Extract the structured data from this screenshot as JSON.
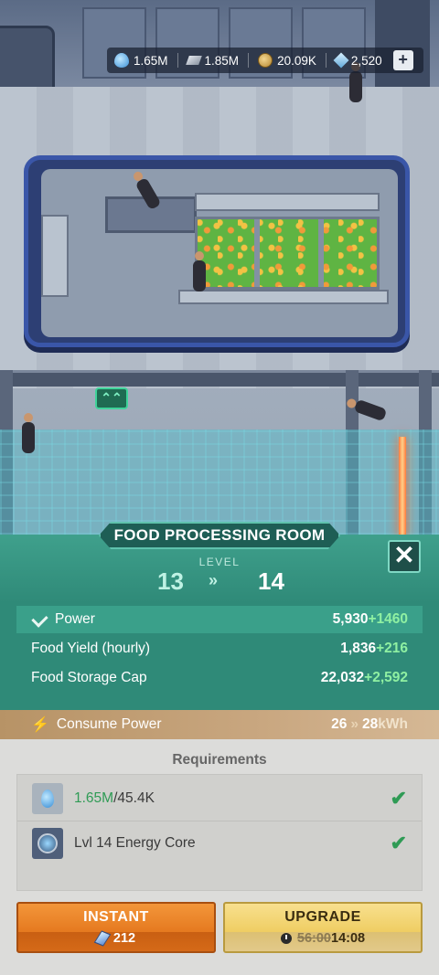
{
  "resources": {
    "water": {
      "icon": "water-drop-icon",
      "value": "1.65M"
    },
    "metal": {
      "icon": "metal-ingot-icon",
      "value": "1.85M"
    },
    "coins": {
      "icon": "coin-icon",
      "value": "20.09K"
    },
    "gems": {
      "icon": "gem-icon",
      "value": "2,520"
    },
    "add_label": "+"
  },
  "room": {
    "title": "FOOD PROCESSING ROOM",
    "level_label": "LEVEL",
    "level_from": "13",
    "level_arrow": "»",
    "level_to": "14",
    "close_label": "✕"
  },
  "stats": [
    {
      "label": "Power",
      "value": "5,930",
      "increase": "+1460"
    },
    {
      "label": "Food Yield (hourly)",
      "value": "1,836",
      "increase": "+216"
    },
    {
      "label": "Food Storage Cap",
      "value": "22,032",
      "increase": "+2,592"
    }
  ],
  "consume": {
    "label": "Consume Power",
    "from": "26",
    "arrow": "»",
    "to": "28",
    "unit": "kWh"
  },
  "requirements": {
    "title": "Requirements",
    "items": [
      {
        "icon": "water-drop-icon",
        "have": "1.65M",
        "need": "/45.4K",
        "status": "✔"
      },
      {
        "icon": "energy-core-icon",
        "text": "Lvl 14 Energy Core",
        "status": "✔"
      }
    ]
  },
  "buttons": {
    "instant": {
      "label": "INSTANT",
      "cost": "212"
    },
    "upgrade": {
      "label": "UPGRADE",
      "old_time": "56:00",
      "new_time": "14:08"
    }
  },
  "colors": {
    "panel_teal": "#2f8a78",
    "instant_orange": "#e5791f",
    "upgrade_yellow": "#efcd62",
    "increase_green": "#8ff0a2"
  }
}
